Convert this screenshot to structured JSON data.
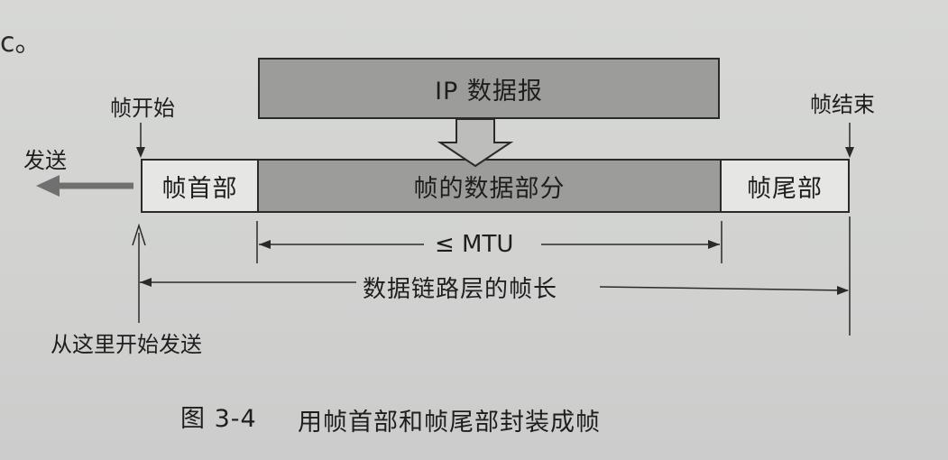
{
  "diagram": {
    "ip_datagram": "IP 数据报",
    "frame_header": "帧首部",
    "frame_data": "帧的数据部分",
    "frame_trailer": "帧尾部",
    "frame_start": "帧开始",
    "frame_end": "帧结束",
    "send": "发送",
    "mtu": "≤ MTU",
    "frame_length": "数据链路层的帧长",
    "start_from_here": "从这里开始发送"
  },
  "figure": {
    "number": "图 3-4",
    "caption": "用帧首部和帧尾部封装成帧"
  },
  "colors": {
    "dark_fill": "#9c9d9b",
    "light_fill": "#e6e6e4",
    "line": "#2a2a2a"
  }
}
